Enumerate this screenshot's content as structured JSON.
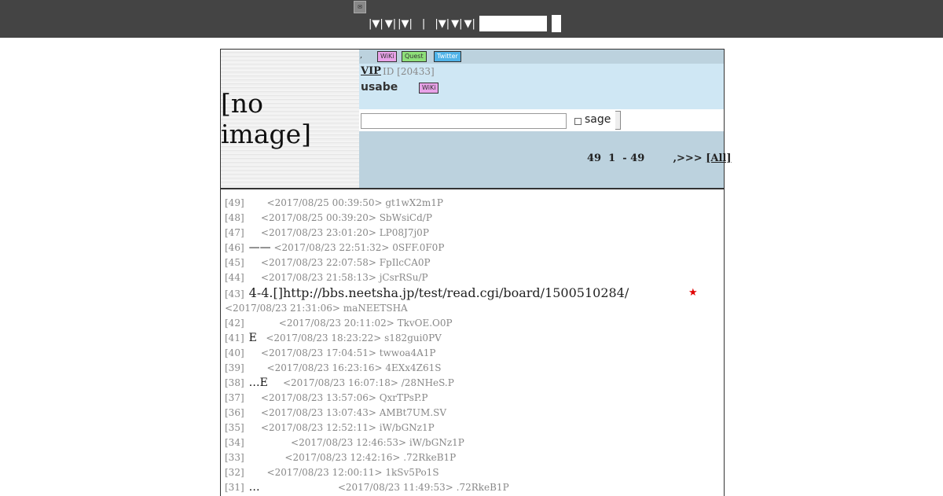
{
  "topbar": {
    "icon": "site-icon",
    "nav_items": [
      "|▼|",
      "▼|",
      "|▼|",
      "|",
      "|▼|",
      "▼|",
      "▼|"
    ],
    "search_placeholder": ""
  },
  "header": {
    "image_placeholder": "[no image]",
    "badges": [
      {
        "label": "WiKi",
        "color": "#e8a2e8"
      },
      {
        "label": "Quest",
        "color": "#8ee07a"
      },
      {
        "label": "Twitter",
        "color": "#4fb3e8"
      }
    ],
    "dot": ",",
    "board_name": "VIP",
    "board_id": "ID [20433]",
    "owner": "usabe",
    "owner_badge": "WiKi",
    "sage_label": "sage",
    "pager_count": "49",
    "pager_range_start": "1",
    "pager_range_end": "- 49",
    "pager_next": ",>>>",
    "pager_all": "[All]"
  },
  "posts": [
    {
      "num": "[49]",
      "text": "",
      "indent": "      ",
      "meta": "<2017/08/25 00:39:50> gt1wX2m1P"
    },
    {
      "num": "[48]",
      "text": "",
      "indent": "    ",
      "meta": "<2017/08/25 00:39:20> SbWsiCd/P"
    },
    {
      "num": "[47]",
      "text": "",
      "indent": "    ",
      "meta": "<2017/08/23 23:01:20> LP08J7j0P"
    },
    {
      "num": "[46]",
      "text": "——",
      "indent": " ",
      "meta": "<2017/08/23 22:51:32> 0SFF.0F0P"
    },
    {
      "num": "[45]",
      "text": "",
      "indent": "    ",
      "meta": "<2017/08/23 22:07:58> FpIlcCA0P"
    },
    {
      "num": "[44]",
      "text": "",
      "indent": "    ",
      "meta": "<2017/08/23 21:58:13> jCsrRSu/P"
    },
    {
      "num": "[43]",
      "text": "4-4.[]http://bbs.neetsha.jp/test/read.cgi/board/1500510284/",
      "indent": "",
      "meta": "",
      "big": true,
      "star": "★"
    },
    {
      "num": "",
      "text": "",
      "indent": "",
      "meta": "<2017/08/23 21:31:06> maNEETSHA"
    },
    {
      "num": "[42]",
      "text": "",
      "indent": "          ",
      "meta": "<2017/08/23 20:11:02> TkvOE.O0P"
    },
    {
      "num": "[41]",
      "text": "E",
      "indent": "   ",
      "meta": "<2017/08/23 18:23:22> s182gui0PV"
    },
    {
      "num": "[40]",
      "text": "",
      "indent": "    ",
      "meta": "<2017/08/23 17:04:51> twwoa4A1P"
    },
    {
      "num": "[39]",
      "text": "",
      "indent": "      ",
      "meta": "<2017/08/23 16:23:16> 4EXx4Z61S"
    },
    {
      "num": "[38]",
      "text": "…E",
      "indent": "     ",
      "meta": "<2017/08/23 16:07:18> /28NHeS.P"
    },
    {
      "num": "[37]",
      "text": "",
      "indent": "    ",
      "meta": "<2017/08/23 13:57:06> QxrTPsP.P"
    },
    {
      "num": "[36]",
      "text": "",
      "indent": "    ",
      "meta": "<2017/08/23 13:07:43> AMBt7UM.SV"
    },
    {
      "num": "[35]",
      "text": "",
      "indent": "    ",
      "meta": "<2017/08/23 12:52:11> iW/bGNz1P"
    },
    {
      "num": "[34]",
      "text": "",
      "indent": "              ",
      "meta": "<2017/08/23 12:46:53> iW/bGNz1P"
    },
    {
      "num": "[33]",
      "text": "",
      "indent": "            ",
      "meta": "<2017/08/23 12:42:16> .72RkeB1P"
    },
    {
      "num": "[32]",
      "text": "",
      "indent": "      ",
      "meta": "<2017/08/23 12:00:11> 1kSv5Po1S"
    },
    {
      "num": "[31]",
      "text": "…",
      "indent": "                          ",
      "meta": "<2017/08/23 11:49:53> .72RkeB1P"
    }
  ]
}
